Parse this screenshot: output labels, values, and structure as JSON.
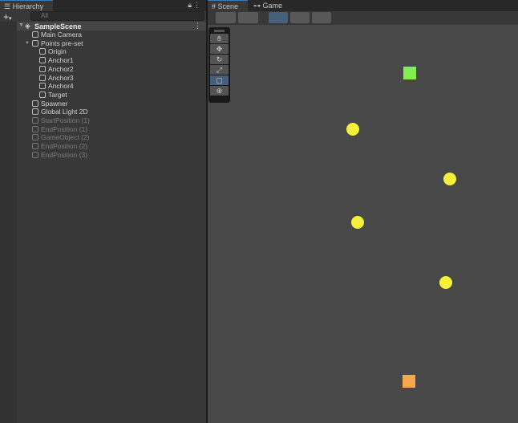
{
  "hierarchy": {
    "tab": "Hierarchy",
    "search_placeholder": "All",
    "scene": "SampleScene",
    "items": [
      {
        "label": "Main Camera",
        "depth": 1,
        "dim": false
      },
      {
        "label": "Points pre-set",
        "depth": 1,
        "dim": false
      },
      {
        "label": "Origin",
        "depth": 2,
        "dim": false
      },
      {
        "label": "Anchor1",
        "depth": 2,
        "dim": false
      },
      {
        "label": "Anchor2",
        "depth": 2,
        "dim": false
      },
      {
        "label": "Anchor3",
        "depth": 2,
        "dim": false
      },
      {
        "label": "Anchor4",
        "depth": 2,
        "dim": false
      },
      {
        "label": "Target",
        "depth": 2,
        "dim": false
      },
      {
        "label": "Spawner",
        "depth": 1,
        "dim": false
      },
      {
        "label": "Global Light 2D",
        "depth": 1,
        "dim": false
      },
      {
        "label": "StartPosition (1)",
        "depth": 1,
        "dim": true
      },
      {
        "label": "EndPosition (1)",
        "depth": 1,
        "dim": true
      },
      {
        "label": "GameObject (2)",
        "depth": 1,
        "dim": true
      },
      {
        "label": "EndPosition (2)",
        "depth": 1,
        "dim": true
      },
      {
        "label": "EndPosition (3)",
        "depth": 1,
        "dim": true
      }
    ]
  },
  "scene": {
    "tabs": [
      "Scene",
      "Game"
    ],
    "tools": [
      "hand",
      "move",
      "rotate",
      "scale",
      "rect",
      "transform"
    ],
    "selected_tool": "rect",
    "colors": {
      "green": "#82ef4e",
      "yellow": "#f5f03a",
      "orange": "#f6a84f"
    }
  }
}
